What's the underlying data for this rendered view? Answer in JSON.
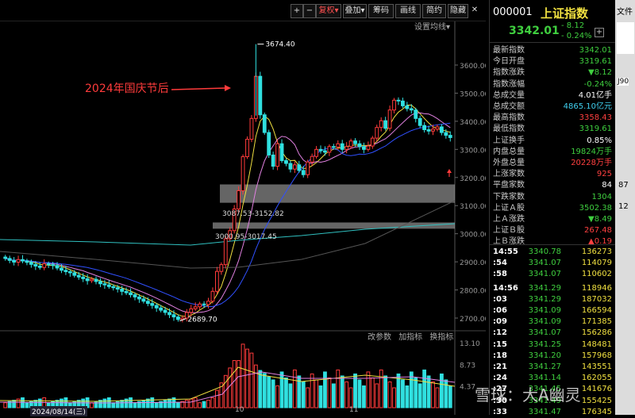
{
  "toolbar": {
    "plus": "+",
    "minus": "−",
    "fuquan": "复权",
    "overlay": "叠加",
    "chip": "筹码",
    "draw": "画线",
    "simple": "简约",
    "hide": "隐藏",
    "settings_label": "设置均线"
  },
  "chart": {
    "annotation": "2024年国庆节后",
    "label_high": "3674.40",
    "label_low": "2689.70",
    "gap1": "3087.53-3152.82",
    "gap2": "3000.95-3017.45",
    "indicator_tools": [
      "改参数",
      "加指标",
      "换指标"
    ],
    "date_left": "2024/08/14(三)",
    "month_10": "10",
    "month_11": "11"
  },
  "chart_data": {
    "type": "candlestick",
    "y_ticks": [
      "3600.00",
      "3500.00",
      "3400.00",
      "3300.00",
      "3200.00",
      "3100.00",
      "3000.00",
      "2900.00",
      "2800.00",
      "2700.00"
    ],
    "vol_ticks": [
      "13.10",
      "8.73",
      "4.37"
    ],
    "high_marker": 3674.4,
    "low_marker": 2689.7,
    "gap_zones": [
      [
        3087.53,
        3152.82
      ],
      [
        3000.95,
        3017.45
      ]
    ]
  },
  "quote": {
    "code": "000001",
    "name": "上证指数",
    "price": "3342.01",
    "change": "- 8.12",
    "pct": "- 0.24%",
    "rows": [
      {
        "label": "最新指数",
        "value": "3342.01",
        "color": "#3fcf3f"
      },
      {
        "label": "今日开盘",
        "value": "3319.61",
        "color": "#3fcf3f"
      },
      {
        "label": "指数涨跌",
        "value": "▼8.12",
        "color": "#3fcf3f"
      },
      {
        "label": "指数涨幅",
        "value": "-0.24%",
        "color": "#3fcf3f"
      },
      {
        "label": "总成交量",
        "value": "4.01亿手",
        "color": "#ffffff"
      },
      {
        "label": "总成交额",
        "value": "4865.10亿元",
        "color": "#40d0f0"
      },
      {
        "label": "最高指数",
        "value": "3358.43",
        "color": "#ff4040"
      },
      {
        "label": "最低指数",
        "value": "3319.61",
        "color": "#3fcf3f"
      },
      {
        "label": "上证换手",
        "value": "0.85%",
        "color": "#ffffff"
      },
      {
        "label": "内盘总量",
        "value": "19824万手",
        "color": "#3fcf3f"
      },
      {
        "label": "外盘总量",
        "value": "20228万手",
        "color": "#ff4040"
      },
      {
        "label": "上涨家数",
        "value": "925",
        "color": "#ff4040"
      },
      {
        "label": "平盘家数",
        "value": "84",
        "color": "#ffffff"
      },
      {
        "label": "下跌家数",
        "value": "1304",
        "color": "#3fcf3f"
      },
      {
        "label": "上证Ａ股",
        "value": "3502.38",
        "color": "#3fcf3f"
      },
      {
        "label": "上Ａ涨跌",
        "value": "▼8.49",
        "color": "#3fcf3f"
      },
      {
        "label": "上证Ｂ股",
        "value": "267.48",
        "color": "#ff4040"
      },
      {
        "label": "上Ｂ涨跌",
        "value": "▲0.19",
        "color": "#ff4040"
      }
    ],
    "trades": [
      {
        "time": "14:55",
        "price": "3340.78",
        "vol": "136273"
      },
      {
        "time": ":54",
        "price": "3341.07",
        "vol": "114079"
      },
      {
        "time": ":58",
        "price": "3341.07",
        "vol": "110602"
      },
      {
        "time": "14:56",
        "price": "3341.29",
        "vol": "118946"
      },
      {
        "time": ":03",
        "price": "3341.29",
        "vol": "187032"
      },
      {
        "time": ":06",
        "price": "3341.09",
        "vol": "166594"
      },
      {
        "time": ":09",
        "price": "3341.09",
        "vol": "171385"
      },
      {
        "time": ":12",
        "price": "3341.07",
        "vol": "156286"
      },
      {
        "time": ":15",
        "price": "3341.25",
        "vol": "148481"
      },
      {
        "time": ":18",
        "price": "3341.20",
        "vol": "157968"
      },
      {
        "time": ":21",
        "price": "3341.27",
        "vol": "143551"
      },
      {
        "time": ":24",
        "price": "3341.14",
        "vol": "162055"
      },
      {
        "time": ":27",
        "price": "3341.45",
        "vol": "141676"
      },
      {
        "time": ":30",
        "price": "3341.49",
        "vol": "155425"
      },
      {
        "time": ":33",
        "price": "3341.47",
        "vol": "176345"
      }
    ]
  },
  "farright": {
    "file_label": "文件",
    "code_hint": "J90",
    "n1": "87",
    "n2": "12"
  },
  "watermark": "雪球：大A幽灵"
}
